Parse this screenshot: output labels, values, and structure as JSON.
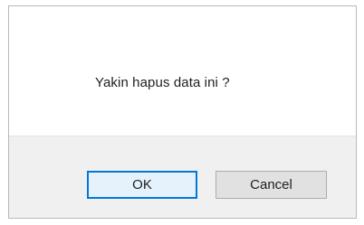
{
  "dialog": {
    "message": "Yakin hapus data ini ?",
    "buttons": {
      "ok_label": "OK",
      "cancel_label": "Cancel"
    }
  },
  "colors": {
    "dialog_border": "#b9b9b9",
    "button_bar_bg": "#f0f0f0",
    "default_button_border": "#0078d7",
    "button_bg": "#e1e1e1"
  }
}
